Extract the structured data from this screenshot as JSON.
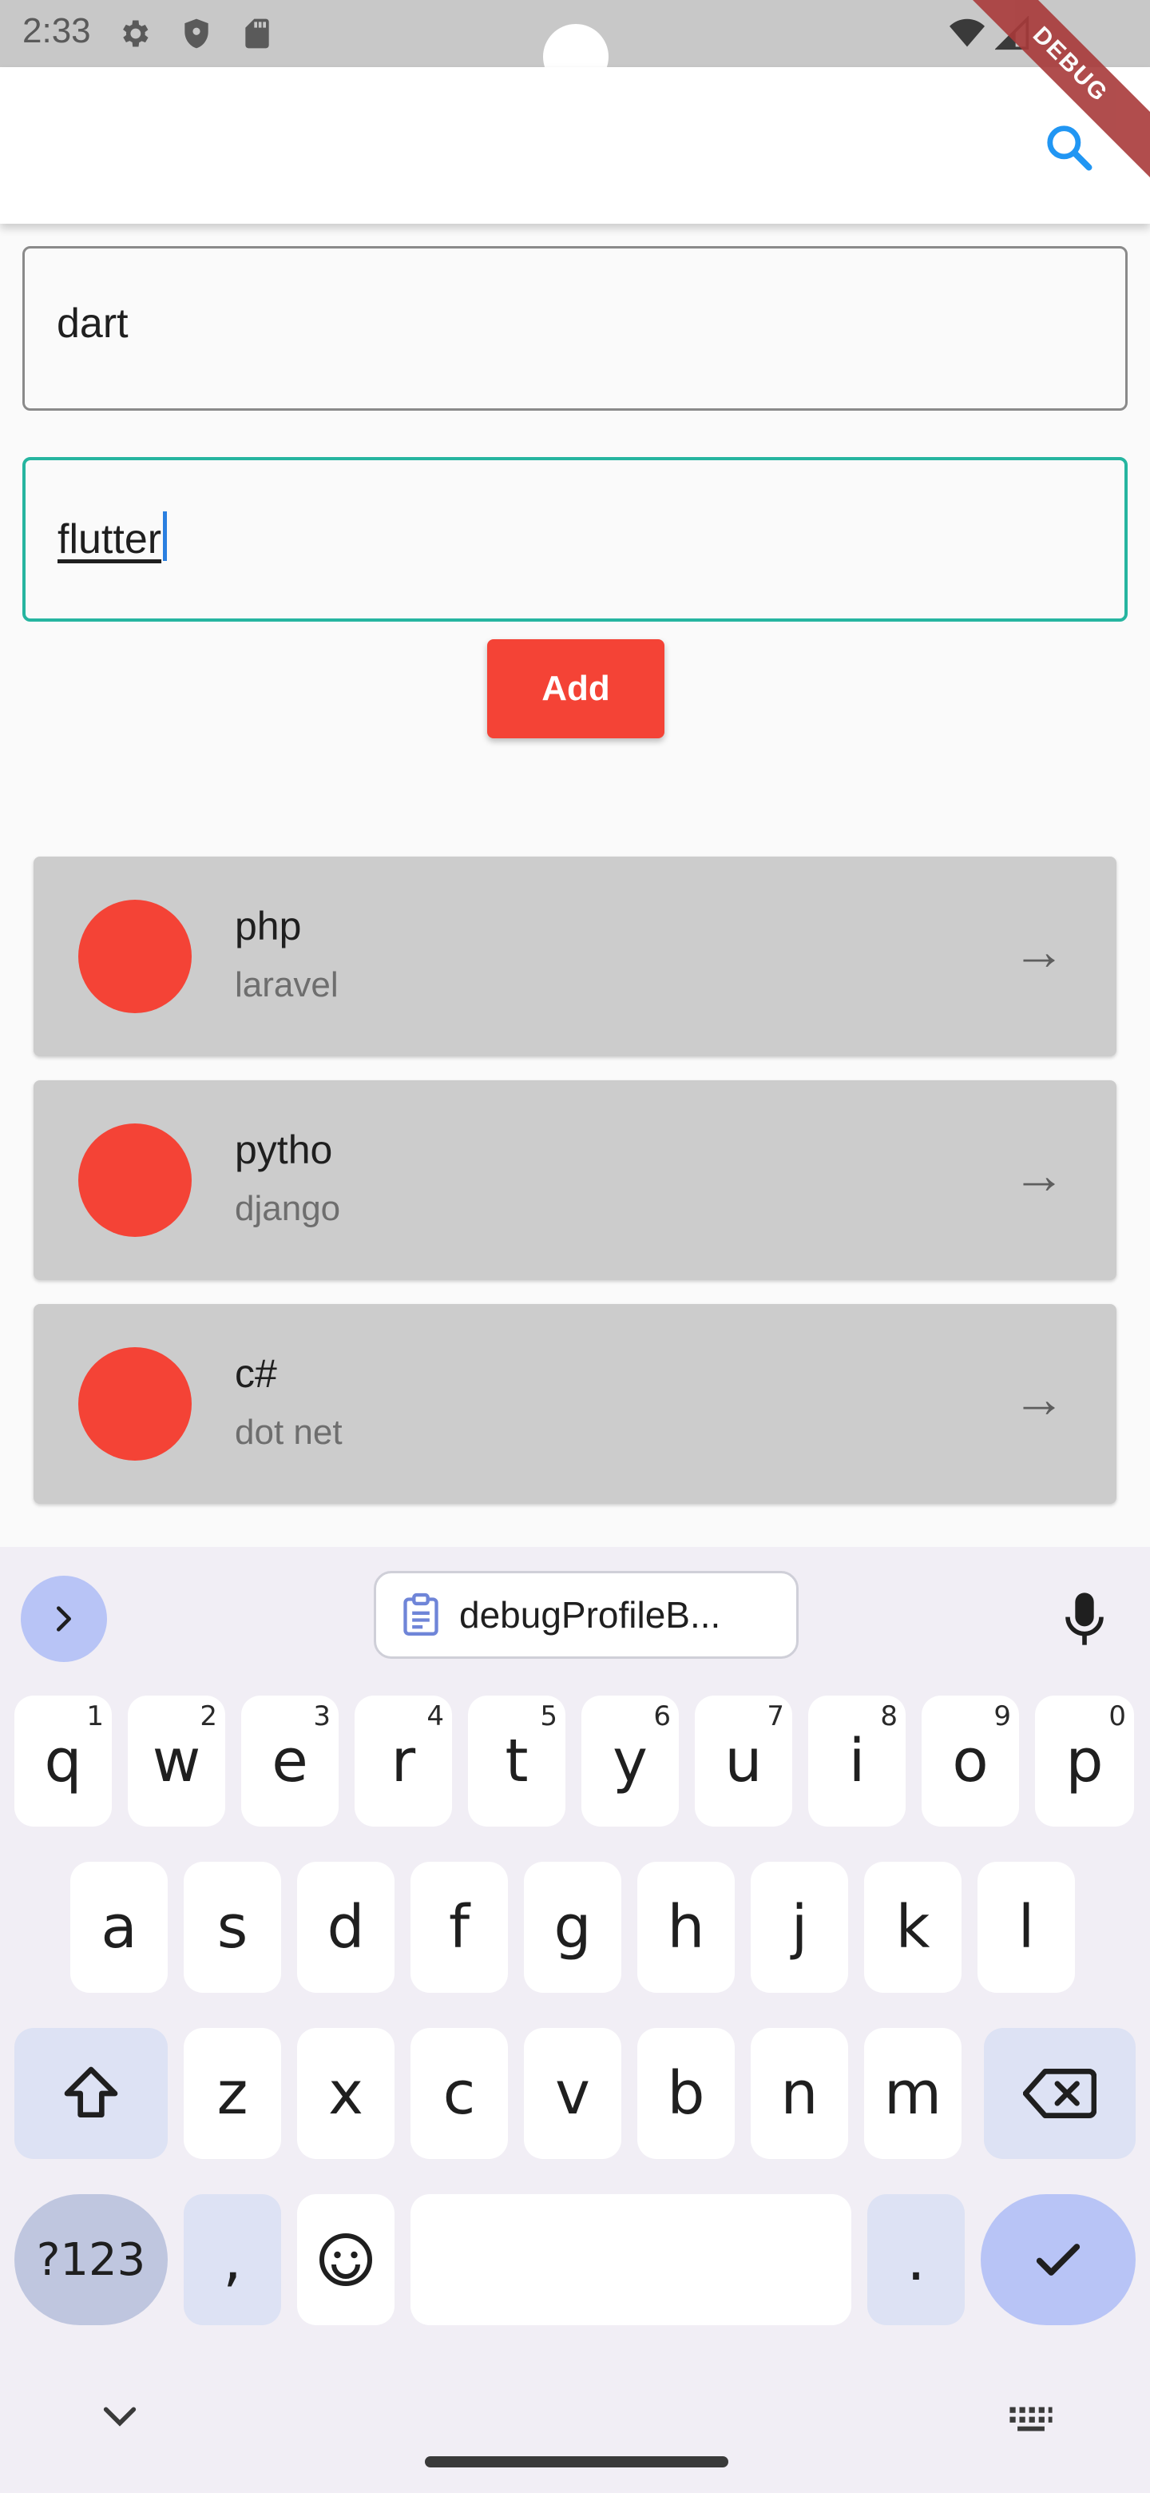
{
  "status_bar": {
    "time": "2:33"
  },
  "debug_banner": "DEBUG",
  "form": {
    "field1_value": "dart",
    "field2_value": "flutter",
    "add_label": "Add"
  },
  "list": [
    {
      "title": "php",
      "subtitle": "laravel"
    },
    {
      "title": "pytho",
      "subtitle": "django"
    },
    {
      "title": "c#",
      "subtitle": "dot net"
    }
  ],
  "keyboard": {
    "clipboard_suggestion": "debugProfileB...",
    "row1": [
      {
        "key": "q",
        "hint": "1"
      },
      {
        "key": "w",
        "hint": "2"
      },
      {
        "key": "e",
        "hint": "3"
      },
      {
        "key": "r",
        "hint": "4"
      },
      {
        "key": "t",
        "hint": "5"
      },
      {
        "key": "y",
        "hint": "6"
      },
      {
        "key": "u",
        "hint": "7"
      },
      {
        "key": "i",
        "hint": "8"
      },
      {
        "key": "o",
        "hint": "9"
      },
      {
        "key": "p",
        "hint": "0"
      }
    ],
    "row2": [
      "a",
      "s",
      "d",
      "f",
      "g",
      "h",
      "j",
      "k",
      "l"
    ],
    "row3": [
      "z",
      "x",
      "c",
      "v",
      "b",
      "n",
      "m"
    ],
    "symbols_label": "?123",
    "comma_label": ",",
    "period_label": "."
  },
  "colors": {
    "accent_red": "#f44336",
    "focus_teal": "#26b5a0",
    "search_blue": "#2196f3"
  }
}
